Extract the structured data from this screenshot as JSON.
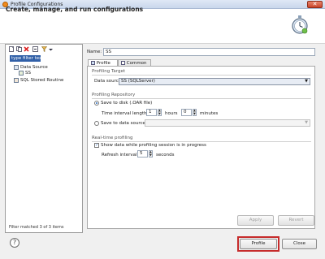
{
  "window": {
    "title": "Profile Configurations",
    "close_glyph": "✕"
  },
  "header": {
    "title": "Create, manage, and run configurations",
    "icon": "stopwatch-icon"
  },
  "left_panel": {
    "toolbar_icons": [
      "new-config-icon",
      "duplicate-icon",
      "delete-icon",
      "collapse-all-icon",
      "filter-icon",
      "view-menu-icon"
    ],
    "filter_value": "type filter text",
    "tree": [
      {
        "label": "Data Source",
        "icon": "data-source-icon",
        "level": 1
      },
      {
        "label": "SS",
        "icon": "configuration-icon",
        "level": 2
      },
      {
        "label": "SQL Stored Routine",
        "icon": "stored-routine-icon",
        "level": 1
      }
    ],
    "status": "Filter matched 3 of 3 items"
  },
  "config": {
    "name_label": "Name:",
    "name_value": "SS",
    "tabs": [
      {
        "label": "Profile",
        "icon": "profile-tab-icon",
        "active": true
      },
      {
        "label": "Common",
        "icon": "common-tab-icon",
        "active": false
      }
    ],
    "profiling_target": {
      "title": "Profiling Target",
      "data_source_label": "Data source:",
      "data_source_value": "SS (SQLServer)"
    },
    "profiling_repository": {
      "title": "Profiling Repository",
      "save_to_disk_label": "Save to disk (.OAR file)",
      "time_interval_label": "Time interval length:",
      "hours_value": "1",
      "hours_label": "hours",
      "minutes_value": "0",
      "minutes_label": "minutes",
      "save_to_ds_label": "Save to data source:",
      "save_to_ds_value": ""
    },
    "real_time": {
      "title": "Real-time profiling",
      "show_data_label": "Show data while profiling session is in progress",
      "refresh_label": "Refresh interval:",
      "refresh_value": "5",
      "seconds_label": "seconds"
    },
    "apply_label": "Apply",
    "revert_label": "Revert"
  },
  "footer": {
    "help_glyph": "?",
    "profile_label": "Profile",
    "close_label": "Close"
  },
  "colors": {
    "highlight": "#c62b2b",
    "selection": "#3160a8"
  }
}
